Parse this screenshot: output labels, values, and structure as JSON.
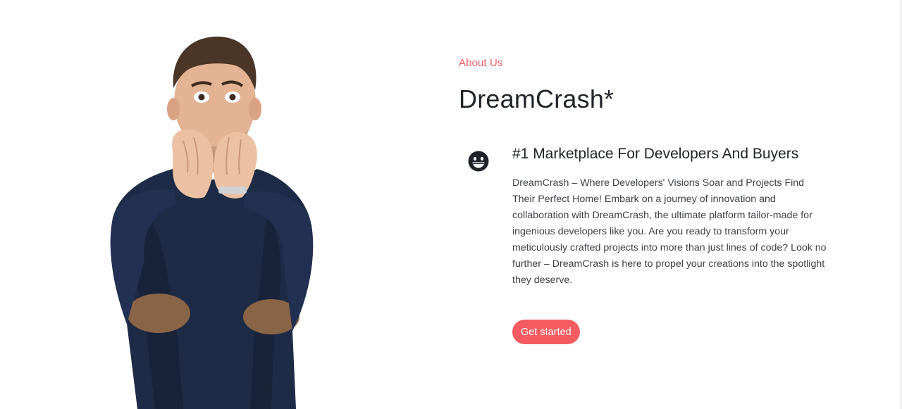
{
  "about": {
    "eyebrow": "About Us",
    "title": "DreamCrash*"
  },
  "feature": {
    "icon": "laughing-face-icon",
    "title": "#1 Marketplace For Developers And Buyers",
    "text": "DreamCrash – Where Developers' Visions Soar and Projects Find Their Perfect Home! Embark on a journey of innovation and collaboration with DreamCrash, the ultimate platform tailor-made for ingenious developers like you. Are you ready to transform your meticulously crafted projects into more than just lines of code? Look no further – DreamCrash is here to propel your creations into the spotlight they deserve."
  },
  "cta": {
    "label": "Get started"
  },
  "colors": {
    "accent": "#f45c61",
    "eyebrow": "#ee5b5f",
    "heading": "#1f2329",
    "body": "#3b3f45",
    "sweater": "#1e2b46"
  }
}
